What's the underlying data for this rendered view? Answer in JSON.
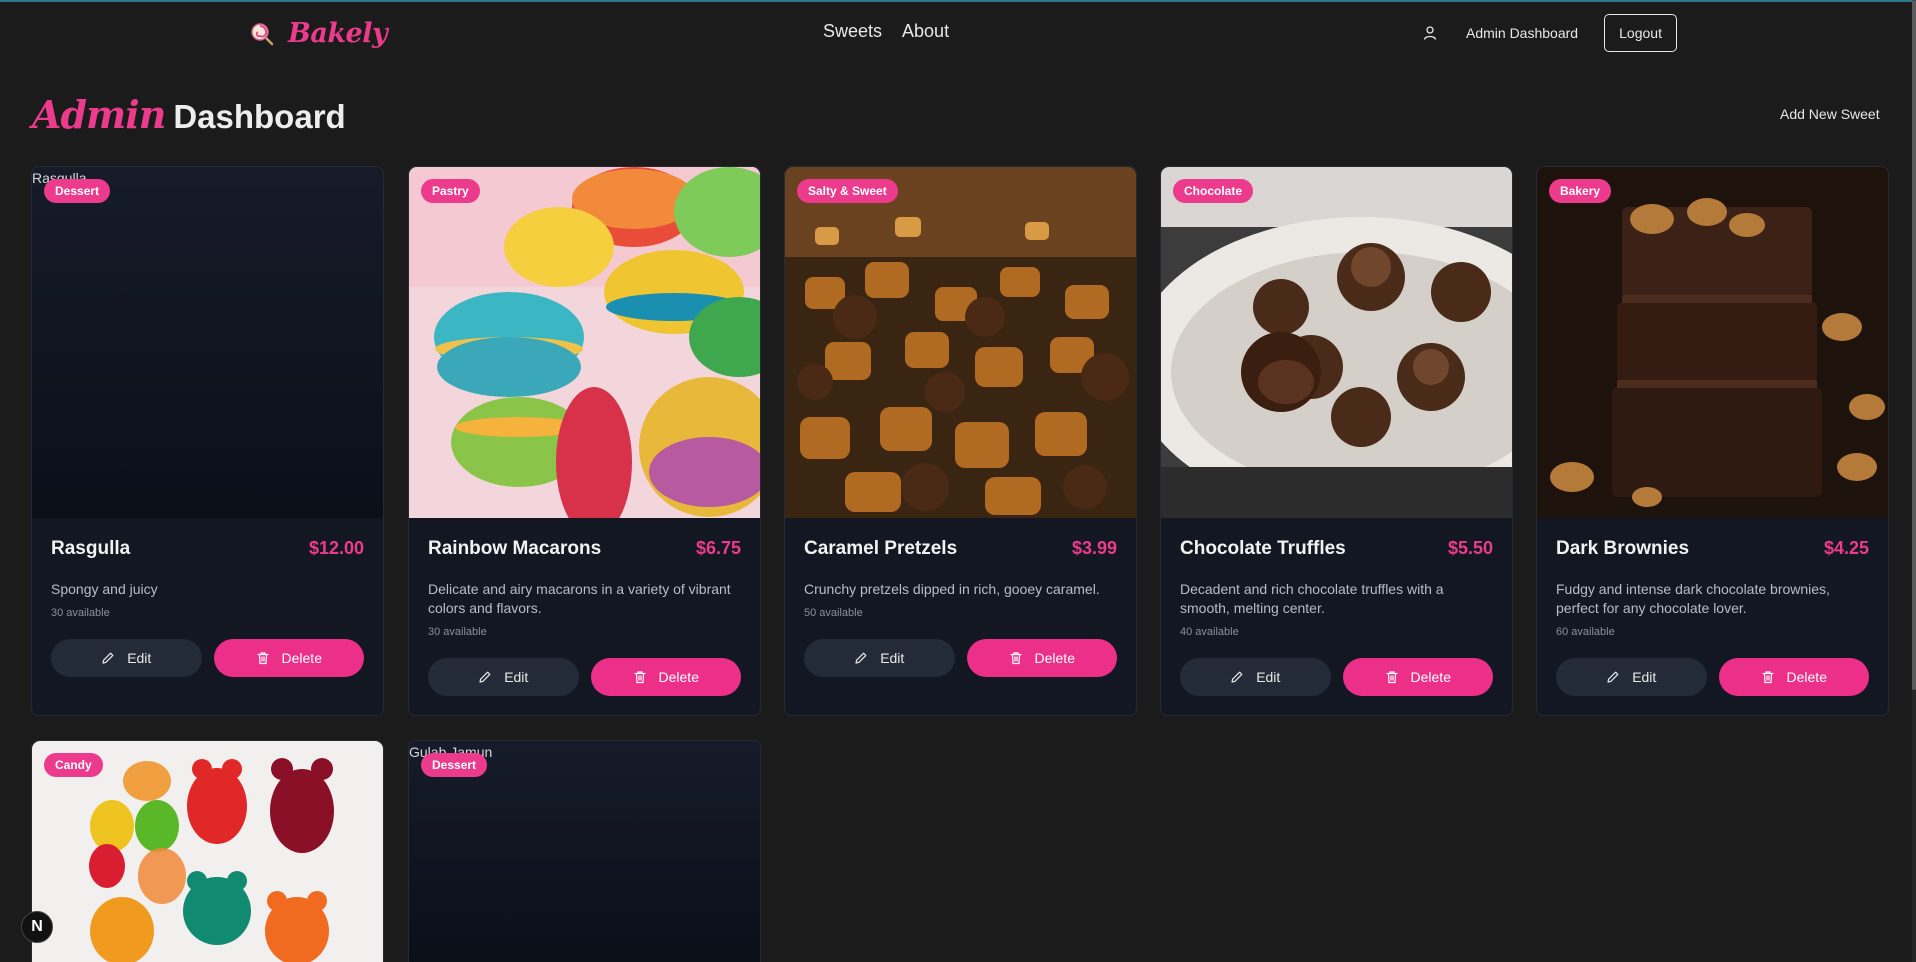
{
  "nav": {
    "brand": "Bakely",
    "links": [
      "Sweets",
      "About"
    ],
    "admin_dashboard": "Admin Dashboard",
    "logout": "Logout"
  },
  "header": {
    "title_script": "Admin",
    "title_main": "Dashboard",
    "add_new": "Add New Sweet"
  },
  "labels": {
    "edit": "Edit",
    "delete": "Delete"
  },
  "cards": [
    {
      "name": "Rasgulla",
      "price": "$12.00",
      "badge": "Dessert",
      "description": "Spongy and juicy",
      "stock": "30 available",
      "image_alt": "Rasgulla",
      "image": "none"
    },
    {
      "name": "Rainbow Macarons",
      "price": "$6.75",
      "badge": "Pastry",
      "description": "Delicate and airy macarons in a variety of vibrant colors and flavors.",
      "stock": "30 available",
      "image": "macarons"
    },
    {
      "name": "Caramel Pretzels",
      "price": "$3.99",
      "badge": "Salty & Sweet",
      "description": "Crunchy pretzels dipped in rich, gooey caramel.",
      "stock": "50 available",
      "image": "pretzels"
    },
    {
      "name": "Chocolate Truffles",
      "price": "$5.50",
      "badge": "Chocolate",
      "description": "Decadent and rich chocolate truffles with a smooth, melting center.",
      "stock": "40 available",
      "image": "truffles"
    },
    {
      "name": "Dark Brownies",
      "price": "$4.25",
      "badge": "Bakery",
      "description": "Fudgy and intense dark chocolate brownies, perfect for any chocolate lover.",
      "stock": "60 available",
      "image": "brownies"
    },
    {
      "badge": "Candy",
      "image": "gummies"
    },
    {
      "badge": "Dessert",
      "image_alt": "Gulab Jamun",
      "image": "none"
    }
  ],
  "colors": {
    "accent": "#ec3b8c",
    "background": "#1b1b1b",
    "card": "#131722"
  },
  "icons": [
    "lollipop-icon",
    "user-icon",
    "pencil-icon",
    "trash-icon"
  ]
}
